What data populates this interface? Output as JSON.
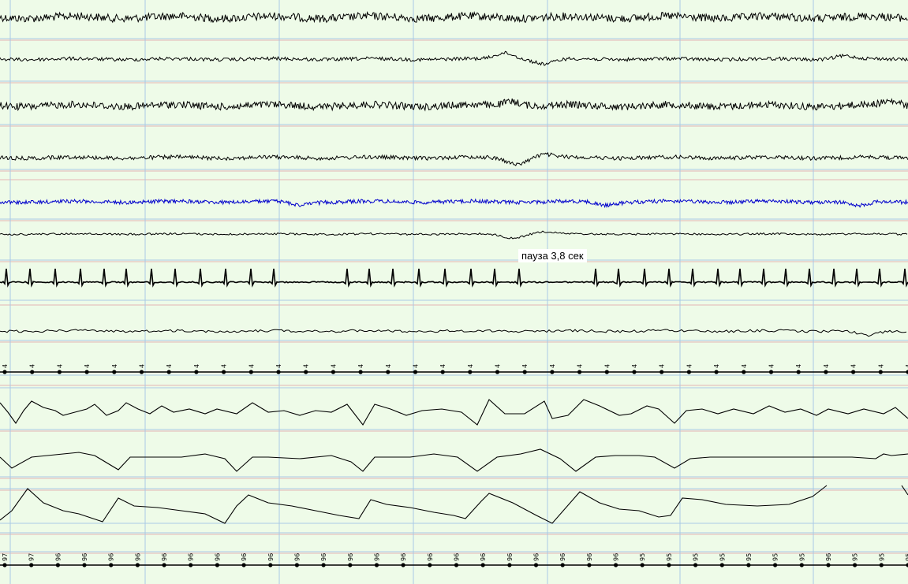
{
  "annotation": {
    "pause_label": "пауза 3,8 сек"
  },
  "colors": {
    "background": "#eefbe8",
    "grid_blue": "#a9c9e6",
    "grid_red": "#e4b4b4",
    "trace": "#000000",
    "trace_blue": "#0000cc"
  },
  "channels": [
    {
      "id": "eeg-1",
      "kind": "noise",
      "color": "trace"
    },
    {
      "id": "eeg-2",
      "kind": "noise",
      "color": "trace"
    },
    {
      "id": "eeg-3",
      "kind": "noise",
      "color": "trace"
    },
    {
      "id": "eeg-4",
      "kind": "noise",
      "color": "trace"
    },
    {
      "id": "eeg-5",
      "kind": "noise",
      "color": "trace_blue"
    },
    {
      "id": "eog",
      "kind": "noise",
      "color": "trace"
    },
    {
      "id": "ecg",
      "kind": "ecg",
      "color": "trace"
    },
    {
      "id": "emg",
      "kind": "noise",
      "color": "trace"
    },
    {
      "id": "heart-rate-markers",
      "kind": "markers",
      "color": "trace"
    },
    {
      "id": "flow",
      "kind": "wave",
      "color": "trace"
    },
    {
      "id": "thorax",
      "kind": "wave",
      "color": "trace"
    },
    {
      "id": "abdomen",
      "kind": "wave",
      "color": "trace"
    },
    {
      "id": "spo2-markers",
      "kind": "markers",
      "color": "trace"
    }
  ],
  "heart_rate_marker_values": [
    "4",
    "4",
    "4",
    "4",
    "4",
    "4",
    "4",
    "4",
    "4",
    "4",
    "4",
    "4",
    "4",
    "4",
    "4",
    "4",
    "4",
    "4",
    "4",
    "4",
    "4",
    "4",
    "4",
    "4",
    "4",
    "4",
    "4",
    "4",
    "4",
    "4",
    "4",
    "4",
    "4",
    "4"
  ],
  "spo2_marker_values": [
    "97",
    "97",
    "96",
    "96",
    "96",
    "96",
    "96",
    "96",
    "96",
    "96",
    "96",
    "96",
    "96",
    "96",
    "96",
    "96",
    "96",
    "96",
    "96",
    "96",
    "96",
    "96",
    "96",
    "96",
    "95",
    "95",
    "95",
    "95",
    "95",
    "95",
    "95",
    "96",
    "95",
    "95",
    "95"
  ]
}
